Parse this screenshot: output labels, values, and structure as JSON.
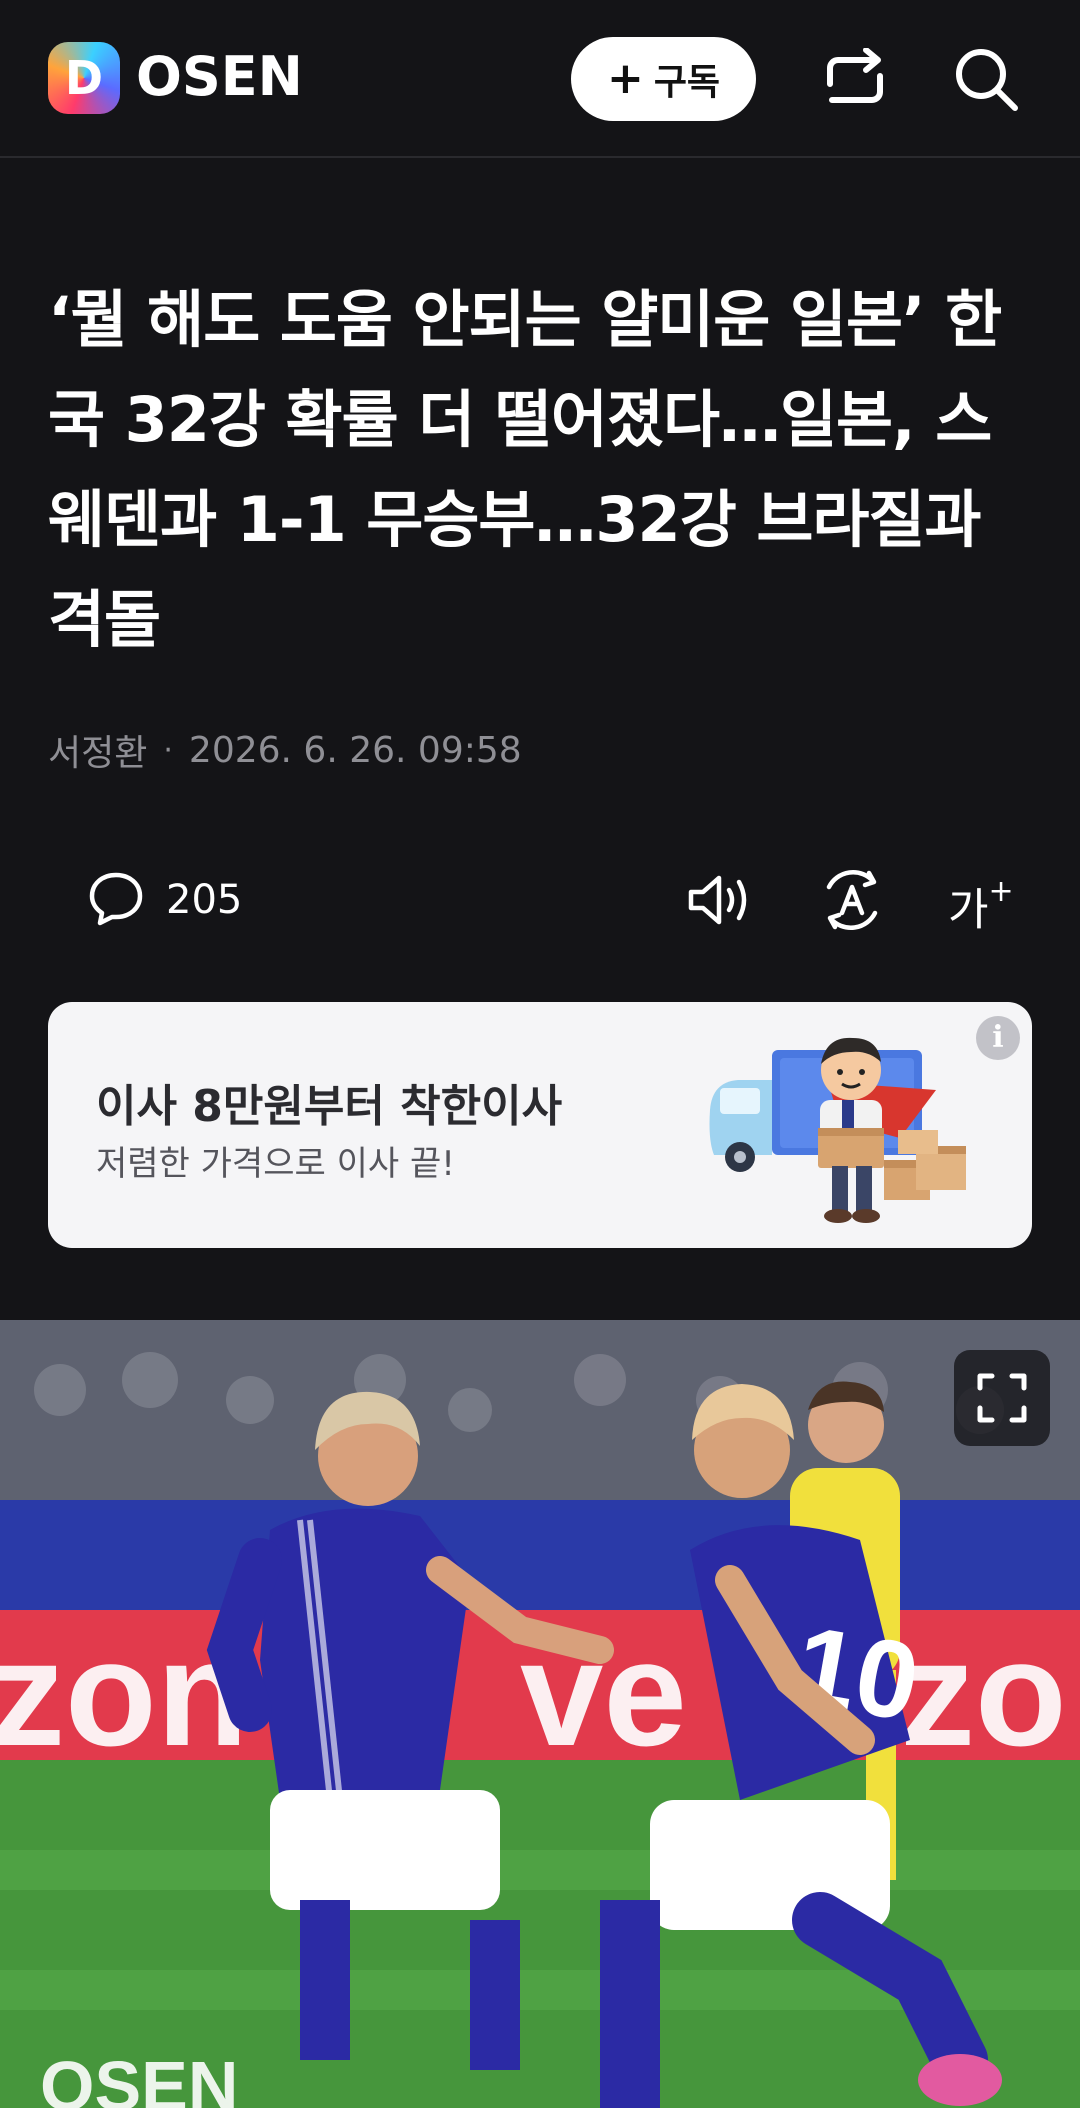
{
  "header": {
    "logo_letter": "D",
    "brand": "OSEN",
    "subscribe_plus": "+",
    "subscribe_label": "구독",
    "icons": [
      "share-icon",
      "search-icon"
    ]
  },
  "article": {
    "title": "‘뭘 해도 도움 안되는 얄미운 일본’ 한국 32강 확률 더 떨어졌다…일본, 스웨덴과 1-1 무승부…32강 브라질과 격돌",
    "author": "서정환",
    "separator": "·",
    "date": "2026. 6. 26. 09:58"
  },
  "actions": {
    "comment_count": "205",
    "font_size_label": "가",
    "font_size_plus": "+",
    "icons": [
      "comment-icon",
      "speaker-icon",
      "translate-icon",
      "font-size-icon"
    ]
  },
  "ad": {
    "title": "이사 8만원부터 착한이사",
    "subtitle": "저렴한 가격으로 이사 끝!",
    "info_symbol": "i"
  },
  "photo": {
    "description_icon": "expand-icon"
  },
  "colors": {
    "background": "#141417",
    "ad_background": "#f5f5f7",
    "meta_text": "#8f8f95"
  }
}
